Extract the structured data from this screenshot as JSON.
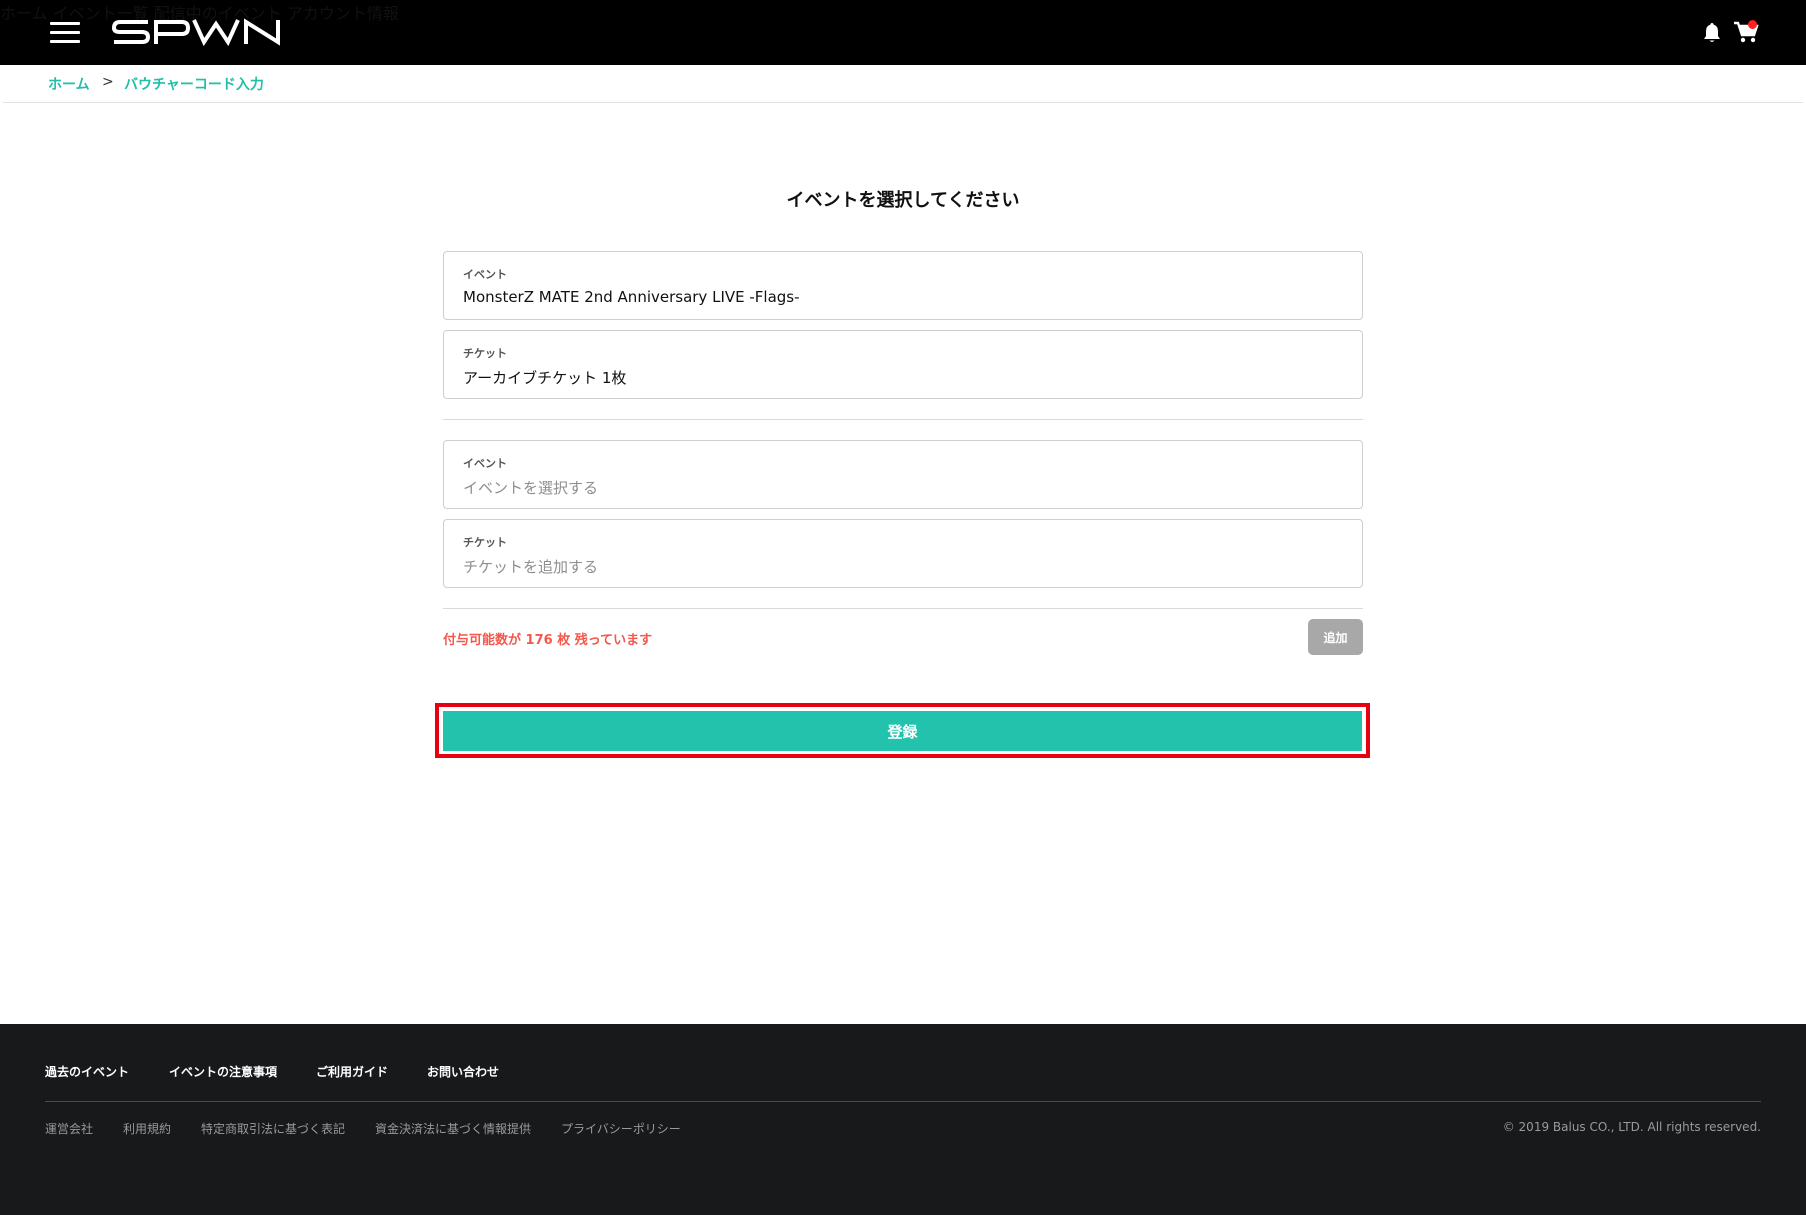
{
  "header": {
    "logo_text": "SPWN",
    "nav": [
      {
        "label": "ホーム"
      },
      {
        "label": "イベント一覧"
      },
      {
        "label": "配信中のイベント"
      },
      {
        "label": "アカウント情報"
      }
    ]
  },
  "breadcrumb": {
    "home": "ホーム",
    "separator": ">",
    "current": "バウチャーコード入力"
  },
  "main": {
    "title": "イベントを選択してください",
    "selected": {
      "event_label": "イベント",
      "event_value": "MonsterZ MATE 2nd Anniversary LIVE -Flags-",
      "ticket_label": "チケット",
      "ticket_value": "アーカイブチケット 1枚"
    },
    "new_entry": {
      "event_label": "イベント",
      "event_placeholder": "イベントを選択する",
      "ticket_label": "チケット",
      "ticket_placeholder": "チケットを追加する"
    },
    "remaining_text": "付与可能数が 176 枚 残っています",
    "add_button": "追加",
    "register_button": "登録"
  },
  "footer": {
    "top_links": [
      {
        "label": "過去のイベント"
      },
      {
        "label": "イベントの注意事項"
      },
      {
        "label": "ご利用ガイド"
      },
      {
        "label": "お問い合わせ"
      }
    ],
    "bottom_links": [
      {
        "label": "運営会社"
      },
      {
        "label": "利用規約"
      },
      {
        "label": "特定商取引法に基づく表記"
      },
      {
        "label": "資金決済法に基づく情報提供"
      },
      {
        "label": "プライバシーポリシー"
      }
    ],
    "copyright": "© 2019 Balus CO., LTD. All rights reserved."
  },
  "colors": {
    "accent": "#23c2ad",
    "link": "#21bfa9",
    "warning": "#f5574a",
    "highlight_outline": "#e50012",
    "header_bg": "#000000",
    "footer_bg": "#18191b"
  }
}
